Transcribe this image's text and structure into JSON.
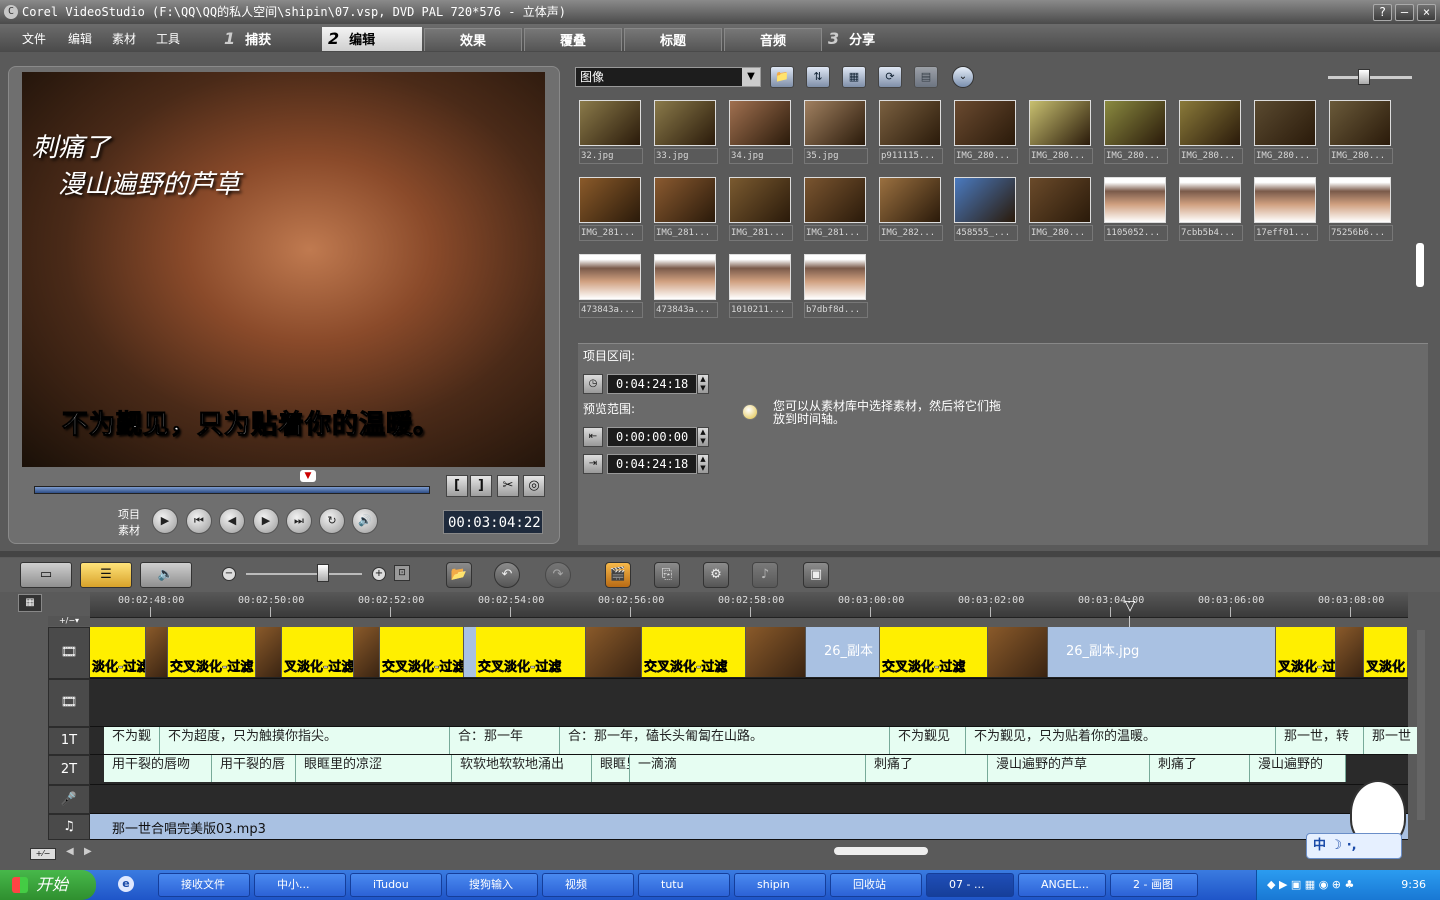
{
  "window": {
    "title": "Corel VideoStudio (F:\\QQ\\QQ的私人空间\\shipin\\07.vsp, DVD PAL 720*576 - 立体声)",
    "help": "?",
    "minimize": "—",
    "close": "×"
  },
  "menu": {
    "items": [
      "文件",
      "编辑",
      "素材",
      "工具"
    ]
  },
  "steps": [
    {
      "num": "1",
      "label": "捕获"
    },
    {
      "num": "2",
      "label": "编辑"
    },
    {
      "num": "3",
      "label": "分享"
    }
  ],
  "subtabs": [
    "效果",
    "覆叠",
    "标题",
    "音频"
  ],
  "preview": {
    "lyric_line1": "刺痛了",
    "lyric_line2": "漫山遍野的芦草",
    "subtitle": "不为觐见，只为贴着你的温暖。",
    "mode_project": "项目",
    "mode_clip": "素材",
    "timecode": "00:03:04:22"
  },
  "library": {
    "category": "图像",
    "thumbs": [
      [
        "32.jpg",
        "33.jpg",
        "34.jpg",
        "35.jpg",
        "p911115...",
        "IMG_280...",
        "IMG_280...",
        "IMG_280...",
        "IMG_280...",
        "IMG_280...",
        "IMG_280..."
      ],
      [
        "IMG_281...",
        "IMG_281...",
        "IMG_281...",
        "IMG_281...",
        "IMG_282...",
        "458555_...",
        "IMG_280...",
        "1105052...",
        "7cbb5b4...",
        "17eff01...",
        "75256b6..."
      ],
      [
        "473843a...",
        "473843a...",
        "1010211...",
        "b7dbf8d..."
      ]
    ],
    "thumb_colors": [
      [
        "#8a7a4a",
        "#8a7a4a",
        "#a07050",
        "#a08060",
        "#7a6040",
        "#6a4a30",
        "#c8c070",
        "#8a8a40",
        "#8a7a3a",
        "#5a4a30",
        "#6a5a3a"
      ],
      [
        "#8a5a2a",
        "#8a5a30",
        "#7a5a30",
        "#7a5530",
        "#9a7040",
        "#4a7ac0",
        "#6a4a2a",
        "#ffffff",
        "#ffffff",
        "#ffffff",
        "#ffffff"
      ],
      [
        "#ffffff",
        "#ffffff",
        "#ffffff",
        "#ffffff"
      ]
    ]
  },
  "properties": {
    "project_range": "项目区间:",
    "project_duration": "0:04:24:18",
    "preview_range": "预览范围:",
    "preview_start": "0:00:00:00",
    "preview_end": "0:04:24:18",
    "tip": "您可以从素材库中选择素材，然后将它们拖放到时间轴。"
  },
  "timeline": {
    "ticks": [
      "00:02:48:00",
      "00:02:50:00",
      "00:02:52:00",
      "00:02:54:00",
      "00:02:56:00",
      "00:02:58:00",
      "00:03:00:00",
      "00:03:02:00",
      "00:03:04:00",
      "00:03:06:00",
      "00:03:08:00"
    ],
    "video_clips": [
      {
        "type": "y",
        "label": "淡化-过滤"
      },
      {
        "type": "img",
        "label": ""
      },
      {
        "type": "y",
        "label": "交叉淡化-过滤"
      },
      {
        "type": "img",
        "label": ""
      },
      {
        "type": "y",
        "label": "叉淡化-过滤"
      },
      {
        "type": "img",
        "label": ""
      },
      {
        "type": "y",
        "label": "交叉淡化-过滤"
      },
      {
        "type": "blue",
        "label": ""
      },
      {
        "type": "y",
        "label": "交叉淡化-过滤"
      },
      {
        "type": "img",
        "label": ""
      },
      {
        "type": "y",
        "label": "交叉淡化-过滤"
      },
      {
        "type": "img",
        "label": ""
      },
      {
        "type": "blue",
        "label": "26_副本"
      },
      {
        "type": "y",
        "label": "交叉淡化-过滤"
      },
      {
        "type": "img",
        "label": ""
      },
      {
        "type": "blue",
        "label": "26_副本.jpg"
      },
      {
        "type": "y",
        "label": "叉淡化-过"
      },
      {
        "type": "img",
        "label": ""
      },
      {
        "type": "y",
        "label": "叉淡化"
      }
    ],
    "title1_clips": [
      "不为觐",
      "不为超度，只为触摸你指尖。",
      "合：那一年",
      "合：那一年，磕长头匍匐在山路。",
      "不为觐见",
      "不为觐见，只为贴着你的温暖。",
      "那一世，转",
      "那一世"
    ],
    "title2_clips": [
      "用干裂的唇吻",
      "用干裂的唇",
      "眼眶里的凉涩",
      "软软地软软地涌出",
      "眼眶里",
      "一滴滴",
      "刺痛了",
      "漫山遍野的芦草",
      "刺痛了",
      "漫山遍野的"
    ],
    "music_clip": "那一世合唱完美版03.mp3",
    "track_labels": {
      "title1": "1T",
      "title2": "2T",
      "music": "♫"
    }
  },
  "taskbar": {
    "start": "开始",
    "items": [
      "接收文件",
      "中小...",
      "iTudou",
      "搜狗输入",
      "视频",
      "tutu",
      "shipin",
      "回收站",
      "07 - ...",
      "ANGEL...",
      "2 - 画图"
    ],
    "clock": "9:36",
    "ime": "中"
  }
}
